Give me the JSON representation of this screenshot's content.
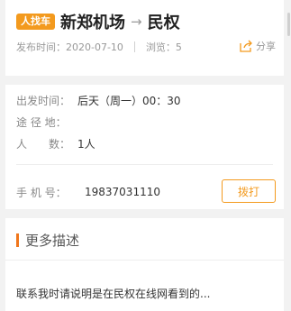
{
  "header": {
    "tag": "人找车",
    "origin": "新郑机场",
    "arrow": "→",
    "destination": "民权",
    "publish_time": "发布时间：2020-07-10",
    "views": "浏览：5",
    "share_label": "分享",
    "tag_color": "#f39a1e"
  },
  "info": {
    "depart_label": "出发时间：",
    "depart_value": "后天（周一）00：30",
    "via_label": "途 径 地：",
    "via_value": "",
    "people_label": "人　　数：",
    "people_value": "1人",
    "phone_label": "手 机 号：",
    "phone_value": "19837031110",
    "call_label": "拨打"
  },
  "more": {
    "section_title": "更多描述",
    "description": "联系我时请说明是在民权在线网看到的..."
  },
  "icons": {
    "share": "share-icon"
  }
}
